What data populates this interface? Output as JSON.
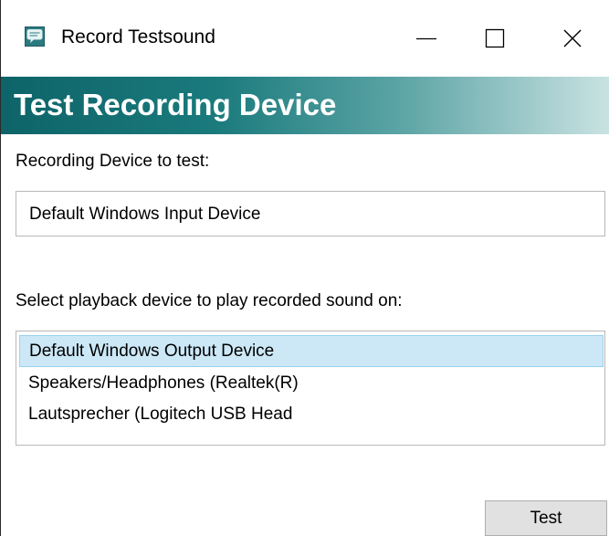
{
  "window": {
    "title": "Record Testsound",
    "app_icon": "speech-bubble-icon",
    "controls": {
      "minimize": "minimize-icon",
      "maximize": "maximize-icon",
      "close": "close-icon"
    }
  },
  "banner": {
    "title": "Test Recording Device"
  },
  "recording": {
    "label": "Recording Device to test:",
    "value": "Default Windows Input Device"
  },
  "playback": {
    "label": "Select playback device to play recorded sound on:",
    "items": [
      {
        "label": "Default Windows Output Device",
        "selected": true
      },
      {
        "label": "Speakers/Headphones (Realtek(R)",
        "selected": false
      },
      {
        "label": "Lautsprecher (Logitech USB Head",
        "selected": false
      }
    ]
  },
  "actions": {
    "test_label": "Test"
  },
  "colors": {
    "banner_start": "#0e6468",
    "banner_end": "#c9e2e2",
    "selection_bg": "#cce8f7",
    "selection_border": "#99d1ef",
    "button_bg": "#e1e1e1"
  }
}
